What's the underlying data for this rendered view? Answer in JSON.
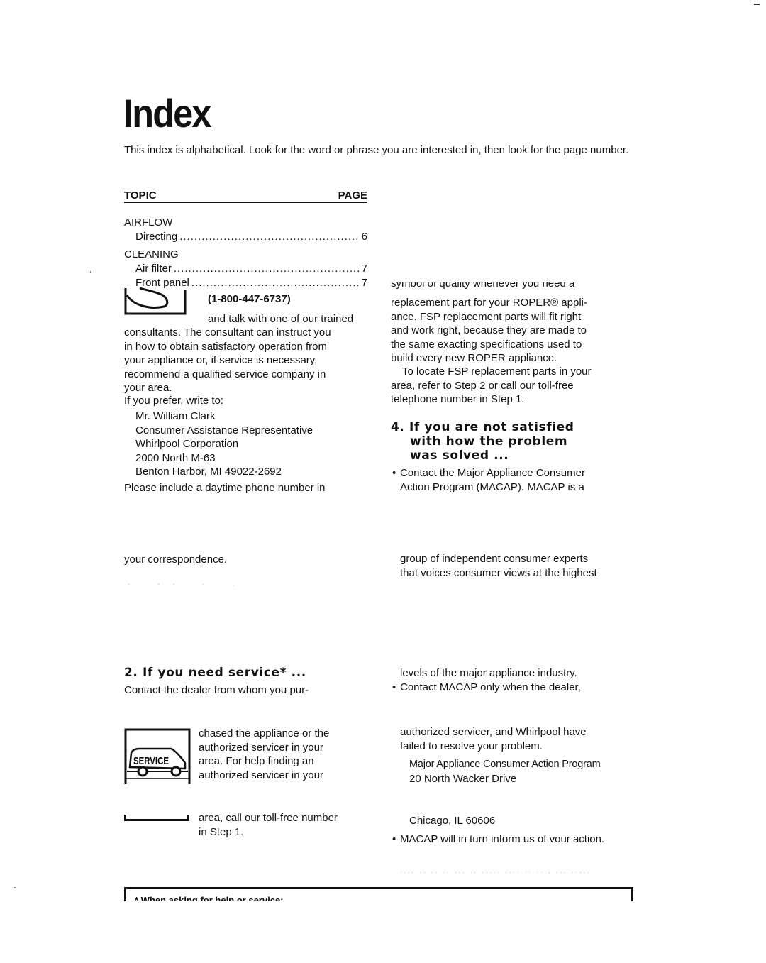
{
  "page": {
    "title": "Index",
    "intro": "This index is alphabetical. Look for the word or phrase you are interested in, then look for the page number."
  },
  "index": {
    "header_topic": "TOPIC",
    "header_page": "PAGE",
    "categories": [
      {
        "name": "AIRFLOW",
        "entries": [
          {
            "label": "Directing",
            "page": "6"
          }
        ]
      },
      {
        "name": "CLEANING",
        "entries": [
          {
            "label": "Air filter",
            "page": "7"
          },
          {
            "label": "Front panel",
            "page": "7"
          }
        ]
      }
    ]
  },
  "left_column": {
    "phone_number": "(1-800-447-6737)",
    "phone_line_1": "and talk with one of our trained",
    "consult_lines": [
      "consultants. The consultant can instruct you",
      "in how to obtain satisfactory operation from",
      "your appliance or, if service is necessary,",
      "recommend a qualified service company in",
      "your area."
    ],
    "write_intro": "If you prefer, write to:",
    "address": [
      "Mr. William Clark",
      "Consumer Assistance Representative",
      "Whirlpool Corporation",
      "2000 North M-63",
      "Benton Harbor, MI 49022-2692"
    ],
    "phone_request_1": "Please include a daytime phone number in",
    "phone_request_2": "your correspondence.",
    "section2_heading": "2. If you need service* ...",
    "section2_line1": "Contact the dealer from whom you pur-",
    "service_icon_label": "SERVICE",
    "section2_lines": [
      "chased the appliance or the",
      "authorized servicer in your",
      "area. For help finding an",
      "authorized servicer in your"
    ],
    "section2_tail": [
      "area, call our toll-free number",
      "in Step 1."
    ]
  },
  "right_column": {
    "cut_line": "symbol of quality whenever you need a",
    "fsp_lines": [
      "replacement part for your ROPER® appli-",
      "ance. FSP replacement parts will fit right",
      "and work right, because they are made to",
      "the same exacting specifications used to",
      "build every new ROPER appliance."
    ],
    "locate_lines": [
      "To locate FSP replacement parts in your",
      "area, refer to Step 2 or call our toll-free",
      "telephone number in Step 1."
    ],
    "section4_heading": [
      "4. If you are not satisfied",
      "with how the problem",
      "was solved ..."
    ],
    "macap_bullet_1": [
      "Contact the Major Appliance Consumer",
      "Action Program (MACAP). MACAP is a"
    ],
    "macap_cont": [
      "group of independent consumer experts",
      "that voices consumer views at the highest"
    ],
    "macap_cont2": "levels of the major appliance industry.",
    "macap_bullet_2": "Contact MACAP only when the dealer,",
    "macap_bullet_2_cont": [
      "authorized servicer, and Whirlpool have",
      "failed to resolve your problem."
    ],
    "macap_address": [
      "Major Appliance Consumer Action Program",
      "20 North Wacker Drive"
    ],
    "macap_city": "Chicago, IL 60606",
    "macap_bullet_3": "MACAP will in turn inform us of vour action."
  },
  "footer": {
    "note": "* When asking for help or service:"
  }
}
